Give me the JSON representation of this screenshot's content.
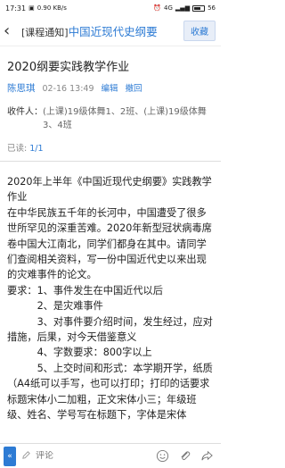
{
  "status": {
    "time": "17:31",
    "net": "0.90 KB/s",
    "signal": "4G",
    "battery": "56"
  },
  "nav": {
    "tag": "[课程通知]",
    "course": "中国近现代史纲要",
    "collect_label": "收藏"
  },
  "doc": {
    "title": "2020纲要实践教学作业",
    "author": "陈思琪",
    "date": "02-16 13:49",
    "edit_label": "编辑",
    "revoke_label": "撤回",
    "recipients_label": "收件人：",
    "recipients": "(上课)19级体舞1、2班、(上课)19级体舞3、4班",
    "read_label": "已读:",
    "read_count": "1/1"
  },
  "content": {
    "lines": [
      "2020年上半年《中国近现代史纲要》实践教学作业",
      "在中华民族五千年的长河中，中国遭受了很多世所罕见的深重苦难。2020年新型冠状病毒席卷中国大江南北，同学们都身在其中。请同学们查阅相关资料，写一份中国近代史以来出现的灾难事件的论文。",
      "要求：1、事件发生在中国近代以后",
      "　　　2、是灾难事件",
      "　　　3、对事件要介绍时间，发生经过，应对措施，后果，对今天借鉴意义",
      "　　　4、字数要求：800字以上",
      "　　　5、上交时间和形式：本学期开学，纸质（A4纸可以手写，也可以打印；打印的话要求标题宋体小二加粗，正文宋体小三；年级班级、姓名、学号写在标题下，字体是宋体"
    ]
  },
  "bottom": {
    "comment_placeholder": "评论"
  },
  "colors": {
    "accent": "#2d7bd4",
    "text": "#222222",
    "muted": "#888888"
  }
}
